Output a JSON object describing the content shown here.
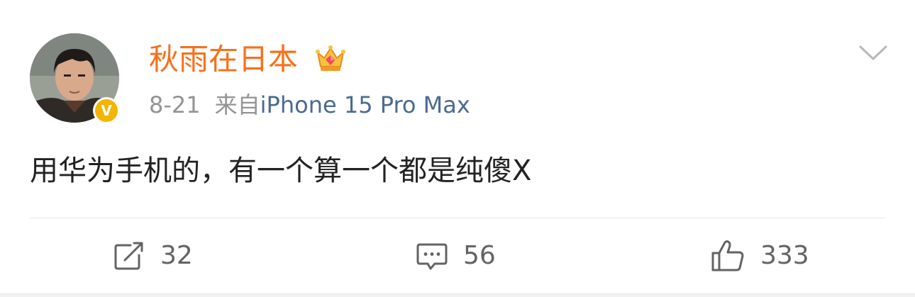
{
  "post": {
    "author": {
      "name": "秋雨在日本",
      "verified_badge": "V",
      "vip_icon": "crown-icon"
    },
    "date": "8-21",
    "source_prefix": "来自",
    "source": "iPhone 15 Pro Max",
    "text": "用华为手机的，有一个算一个都是纯傻X",
    "actions": {
      "reposts": "32",
      "comments": "56",
      "likes": "333"
    }
  },
  "colors": {
    "username": "#f86f1b",
    "source_link": "#4a6a93",
    "meta_gray": "#939393",
    "verified": "#f5b400",
    "action_gray": "#636363"
  }
}
